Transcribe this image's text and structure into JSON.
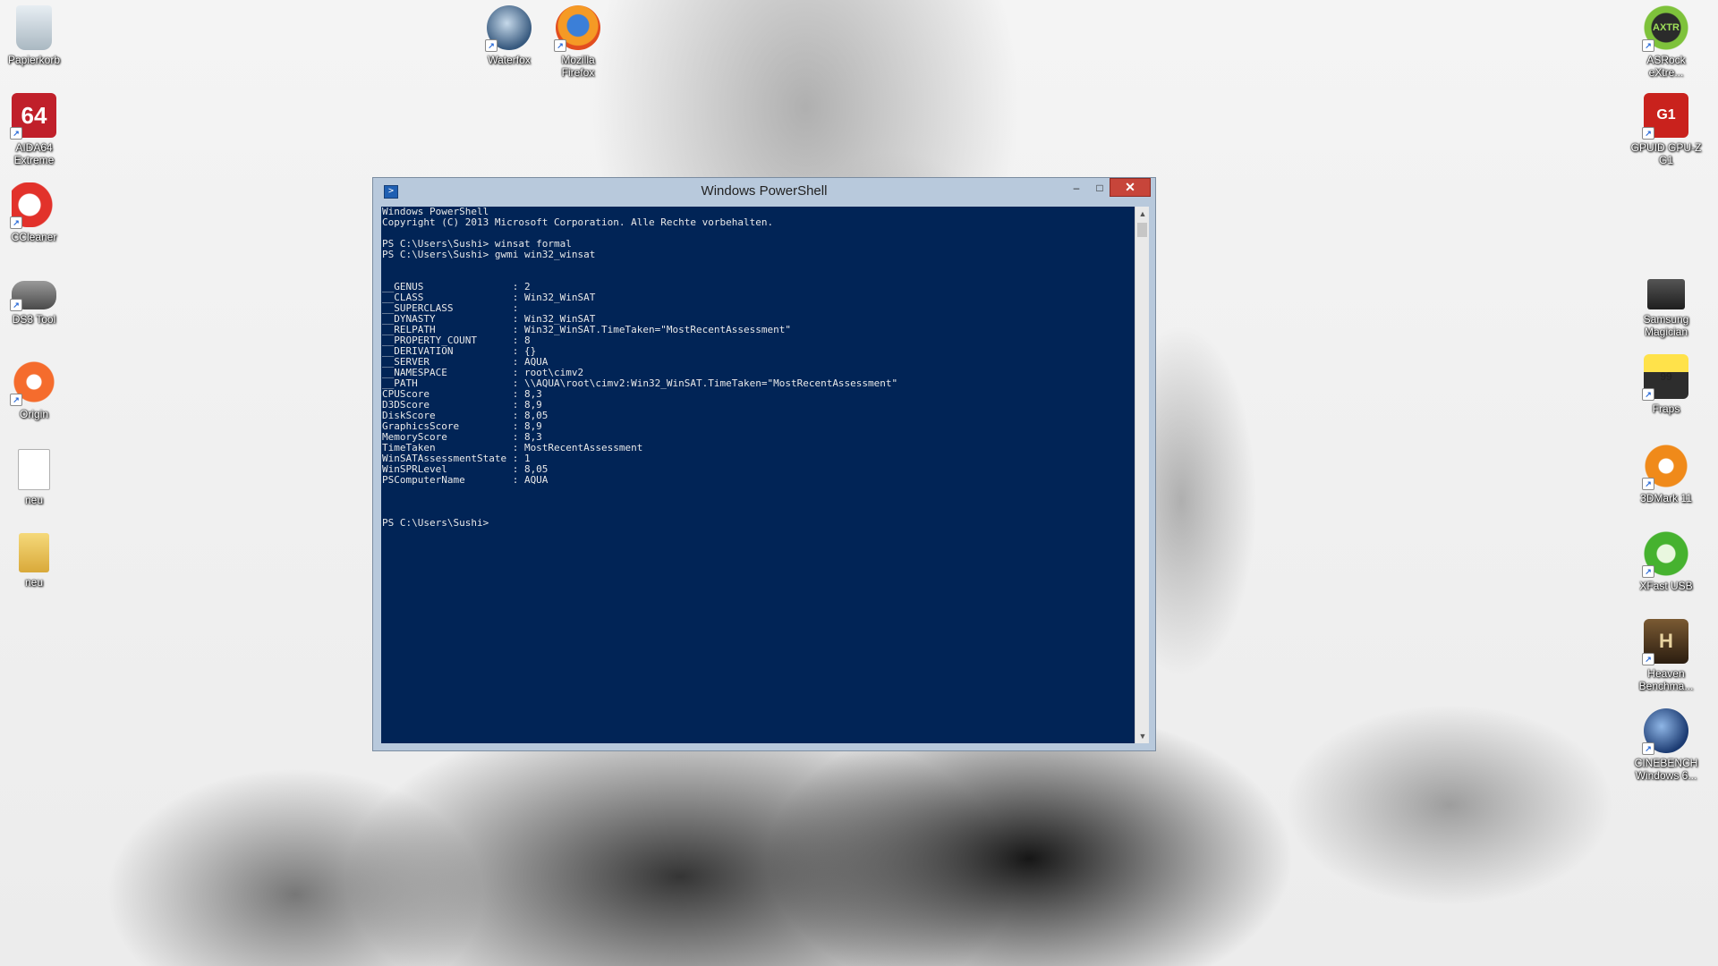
{
  "desktop": {
    "icons_left": [
      {
        "name": "recycle-bin",
        "label": "Papierkorb"
      },
      {
        "name": "aida64",
        "label": "AIDA64\nExtreme"
      },
      {
        "name": "ccleaner",
        "label": "CCleaner"
      },
      {
        "name": "ds3-tool",
        "label": "DS3 Tool"
      },
      {
        "name": "origin",
        "label": "Origin"
      },
      {
        "name": "neu-file",
        "label": "neu"
      },
      {
        "name": "neu-folder",
        "label": "neu"
      }
    ],
    "icons_top": [
      {
        "name": "waterfox",
        "label": "Waterfox"
      },
      {
        "name": "firefox",
        "label": "Mozilla\nFirefox"
      }
    ],
    "icons_right": [
      {
        "name": "asrock",
        "label": "ASRock\neXtre..."
      },
      {
        "name": "gpuz",
        "label": "GPUID GPU-Z\nG1"
      },
      {
        "name": "samsung-magician",
        "label": "Samsung\nMagician"
      },
      {
        "name": "fraps",
        "label": "Fraps"
      },
      {
        "name": "3dmark",
        "label": "3DMark 11"
      },
      {
        "name": "xfast-usb",
        "label": "XFast USB"
      },
      {
        "name": "heaven",
        "label": "Heaven\nBenchma..."
      },
      {
        "name": "cinebench",
        "label": "CINEBENCH\nWindows 6..."
      }
    ]
  },
  "window": {
    "title": "Windows PowerShell",
    "minimize": "–",
    "maximize": "□",
    "close": "✕",
    "console_lines": "Windows PowerShell\nCopyright (C) 2013 Microsoft Corporation. Alle Rechte vorbehalten.\n\nPS C:\\Users\\Sushi> winsat formal\nPS C:\\Users\\Sushi> gwmi win32_winsat\n\n\n__GENUS               : 2\n__CLASS               : Win32_WinSAT\n__SUPERCLASS          :\n__DYNASTY             : Win32_WinSAT\n__RELPATH             : Win32_WinSAT.TimeTaken=\"MostRecentAssessment\"\n__PROPERTY_COUNT      : 8\n__DERIVATION          : {}\n__SERVER              : AQUA\n__NAMESPACE           : root\\cimv2\n__PATH                : \\\\AQUA\\root\\cimv2:Win32_WinSAT.TimeTaken=\"MostRecentAssessment\"\nCPUScore              : 8,3\nD3DScore              : 8,9\nDiskScore             : 8,05\nGraphicsScore         : 8,9\nMemoryScore           : 8,3\nTimeTaken             : MostRecentAssessment\nWinSATAssessmentState : 1\nWinSPRLevel           : 8,05\nPSComputerName        : AQUA\n\n\n\nPS C:\\Users\\Sushi>"
  },
  "colors": {
    "console_bg": "#012456",
    "console_fg": "#e8e8e8",
    "window_frame": "#b8c9dc",
    "close_button": "#c7453a"
  }
}
